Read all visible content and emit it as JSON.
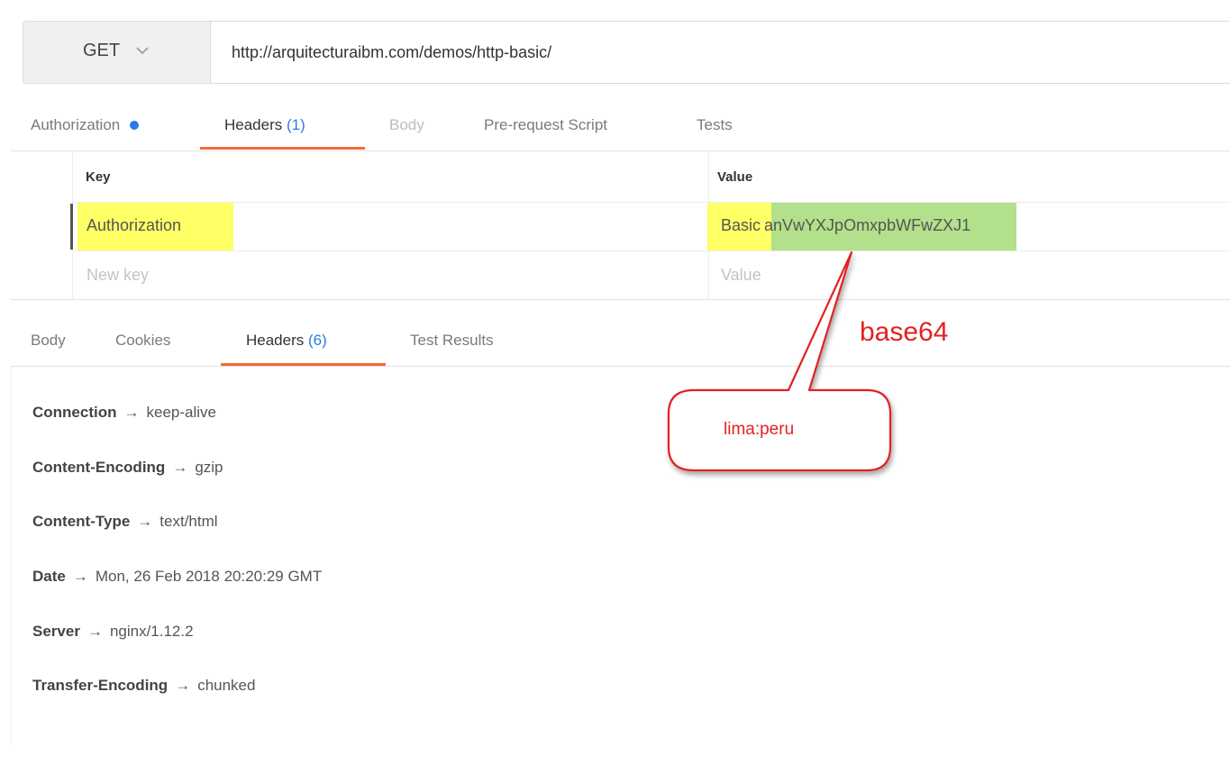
{
  "request": {
    "method": "GET",
    "method_icon": "chevron-down-icon",
    "url": "http://arquitecturaibm.com/demos/http-basic/"
  },
  "request_tabs": [
    {
      "label": "Authorization",
      "has_dot": true,
      "dot_color": "#2c7be5"
    },
    {
      "label": "Headers",
      "count": "(1)",
      "active": true
    },
    {
      "label": "Body",
      "disabled": true
    },
    {
      "label": "Pre-request Script"
    },
    {
      "label": "Tests"
    }
  ],
  "header_table": {
    "col_key": "Key",
    "col_value": "Value",
    "rows": [
      {
        "key": "Authorization",
        "value_prefix": "Basic",
        "value_token": "anVwYXJpOmxpbWFwZXJ1"
      }
    ],
    "new_key_placeholder": "New key",
    "new_value_placeholder": "Value"
  },
  "response_tabs": [
    {
      "label": "Body"
    },
    {
      "label": "Cookies"
    },
    {
      "label": "Headers",
      "count": "(6)",
      "active": true
    },
    {
      "label": "Test Results"
    }
  ],
  "response_headers": [
    {
      "key": "Connection",
      "value": "keep-alive"
    },
    {
      "key": "Content-Encoding",
      "value": "gzip"
    },
    {
      "key": "Content-Type",
      "value": "text/html"
    },
    {
      "key": "Date",
      "value": "Mon, 26 Feb 2018 20:20:29 GMT"
    },
    {
      "key": "Server",
      "value": "nginx/1.12.2"
    },
    {
      "key": "Transfer-Encoding",
      "value": "chunked"
    }
  ],
  "arrow_glyph": "→",
  "annotations": {
    "encoding_label": "base64",
    "decoded_value": "lima:peru",
    "color": "#e32222"
  },
  "colors": {
    "accent_underline": "#f26b3a",
    "count_blue": "#2c7be5",
    "key_highlight": "#ffff66",
    "token_highlight": "#b3e08a"
  }
}
